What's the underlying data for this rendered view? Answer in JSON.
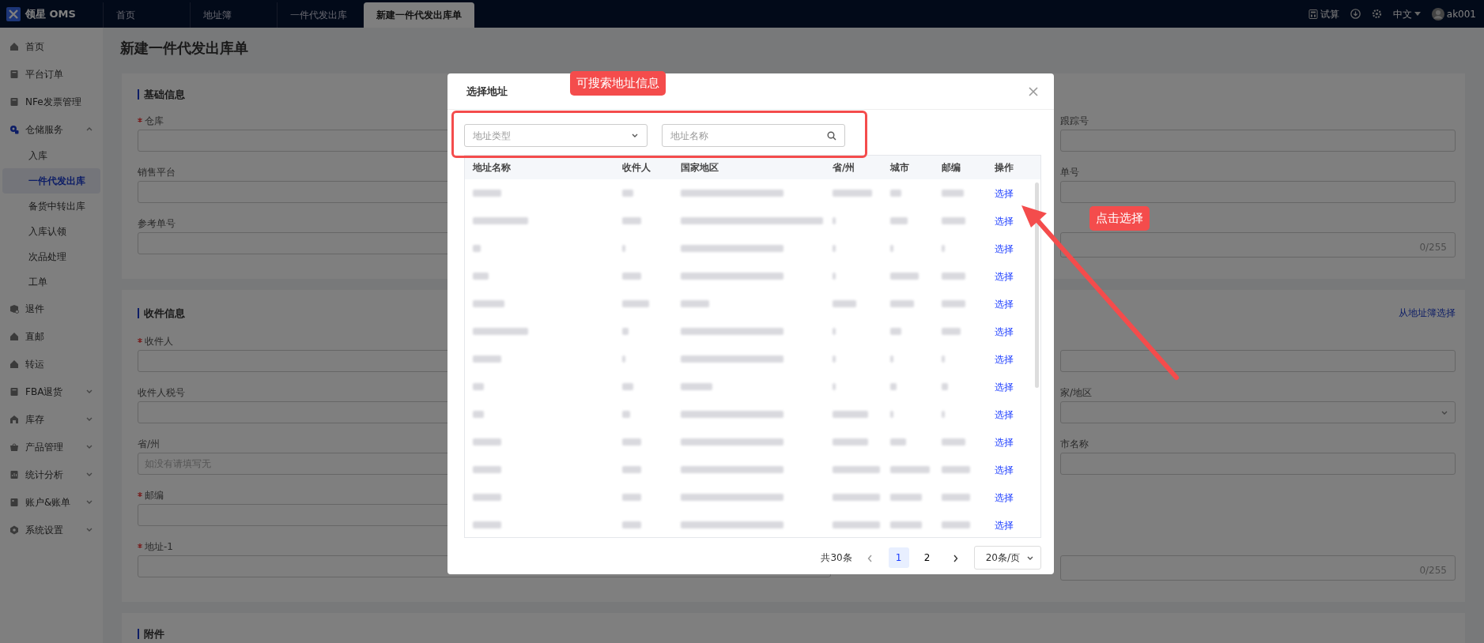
{
  "top_bar": {
    "logo": "领星 OMS",
    "tabs": [
      {
        "label": "首页",
        "selected": false
      },
      {
        "label": "地址簿",
        "selected": false
      },
      {
        "label": "一件代发出库",
        "selected": false
      },
      {
        "label": "新建一件代发出库单",
        "selected": true
      }
    ],
    "trial": "试算",
    "language": "中文",
    "user": "ak001"
  },
  "sidebar": {
    "items": [
      {
        "label": "首页"
      },
      {
        "label": "平台订单"
      },
      {
        "label": "NFe发票管理"
      },
      {
        "label": "仓储服务",
        "expanded": true,
        "children": [
          {
            "label": "入库",
            "selected": false
          },
          {
            "label": "一件代发出库",
            "selected": true
          },
          {
            "label": "备货中转出库",
            "selected": false
          },
          {
            "label": "入库认领",
            "selected": false
          },
          {
            "label": "次品处理",
            "selected": false
          },
          {
            "label": "工单",
            "selected": false
          }
        ]
      },
      {
        "label": "退件"
      },
      {
        "label": "直邮"
      },
      {
        "label": "转运"
      },
      {
        "label": "FBA退货",
        "expanded": false
      },
      {
        "label": "库存",
        "expanded": false
      },
      {
        "label": "产品管理",
        "expanded": false
      },
      {
        "label": "统计分析",
        "expanded": false
      },
      {
        "label": "账户&账单",
        "expanded": false
      },
      {
        "label": "系统设置",
        "expanded": false
      }
    ]
  },
  "page": {
    "title": "新建一件代发出库单",
    "sections": [
      {
        "title": "基础信息",
        "rows": [
          {
            "left": {
              "label": "仓库",
              "required": true,
              "kind": "input"
            },
            "right": {
              "label": "跟踪号",
              "kind": "input"
            }
          },
          {
            "left": {
              "label": "销售平台",
              "kind": "input"
            },
            "right": {
              "label": "单号",
              "kind": "input"
            }
          },
          {
            "left": {
              "label": "参考单号",
              "kind": "input"
            },
            "right": {
              "kind": "textarea",
              "counter": "0/255"
            }
          }
        ]
      },
      {
        "title": "收件信息",
        "link": "从地址簿选择",
        "rows": [
          {
            "left": {
              "label": "收件人",
              "required": true,
              "kind": "input"
            },
            "right": {
              "kind": "input"
            }
          },
          {
            "left": {
              "label": "收件人税号",
              "kind": "input"
            },
            "right": {
              "label": "家/地区",
              "kind": "select"
            }
          },
          {
            "left": {
              "label": "省/州",
              "kind": "input",
              "placeholder": "如没有请填写无"
            },
            "right": {
              "label": "市名称",
              "kind": "input"
            }
          },
          {
            "left": {
              "label": "邮编",
              "required": true,
              "kind": "input"
            }
          },
          {
            "left": {
              "label": "地址-1",
              "required": true,
              "kind": "input"
            },
            "right": {
              "kind": "textarea",
              "counter": "0/255"
            }
          }
        ]
      },
      {
        "title": "附件"
      }
    ]
  },
  "modal": {
    "title": "选择地址",
    "type_select": {
      "placeholder": "地址类型"
    },
    "search": {
      "placeholder": "地址名称"
    },
    "table": {
      "columns": [
        "地址名称",
        "收件人",
        "国家地区",
        "省/州",
        "城市",
        "邮编",
        "操作"
      ],
      "rows": [
        {
          "action": "选择"
        },
        {
          "action": "选择"
        },
        {
          "action": "选择"
        },
        {
          "action": "选择"
        },
        {
          "action": "选择"
        },
        {
          "action": "选择"
        },
        {
          "action": "选择"
        },
        {
          "action": "选择"
        },
        {
          "action": "选择"
        },
        {
          "action": "选择"
        },
        {
          "action": "选择"
        },
        {
          "action": "选择"
        },
        {
          "action": "选择"
        }
      ]
    },
    "pagination": {
      "total": "共30条",
      "pages": [
        {
          "label": "1",
          "selected": true
        },
        {
          "label": "2",
          "selected": false
        }
      ],
      "page_size": "20条/页"
    }
  },
  "annotations": [
    {
      "kind": "label",
      "text": "可搜索地址信息"
    },
    {
      "kind": "box"
    },
    {
      "kind": "label",
      "text": "点击选择"
    },
    {
      "kind": "arrow"
    }
  ]
}
